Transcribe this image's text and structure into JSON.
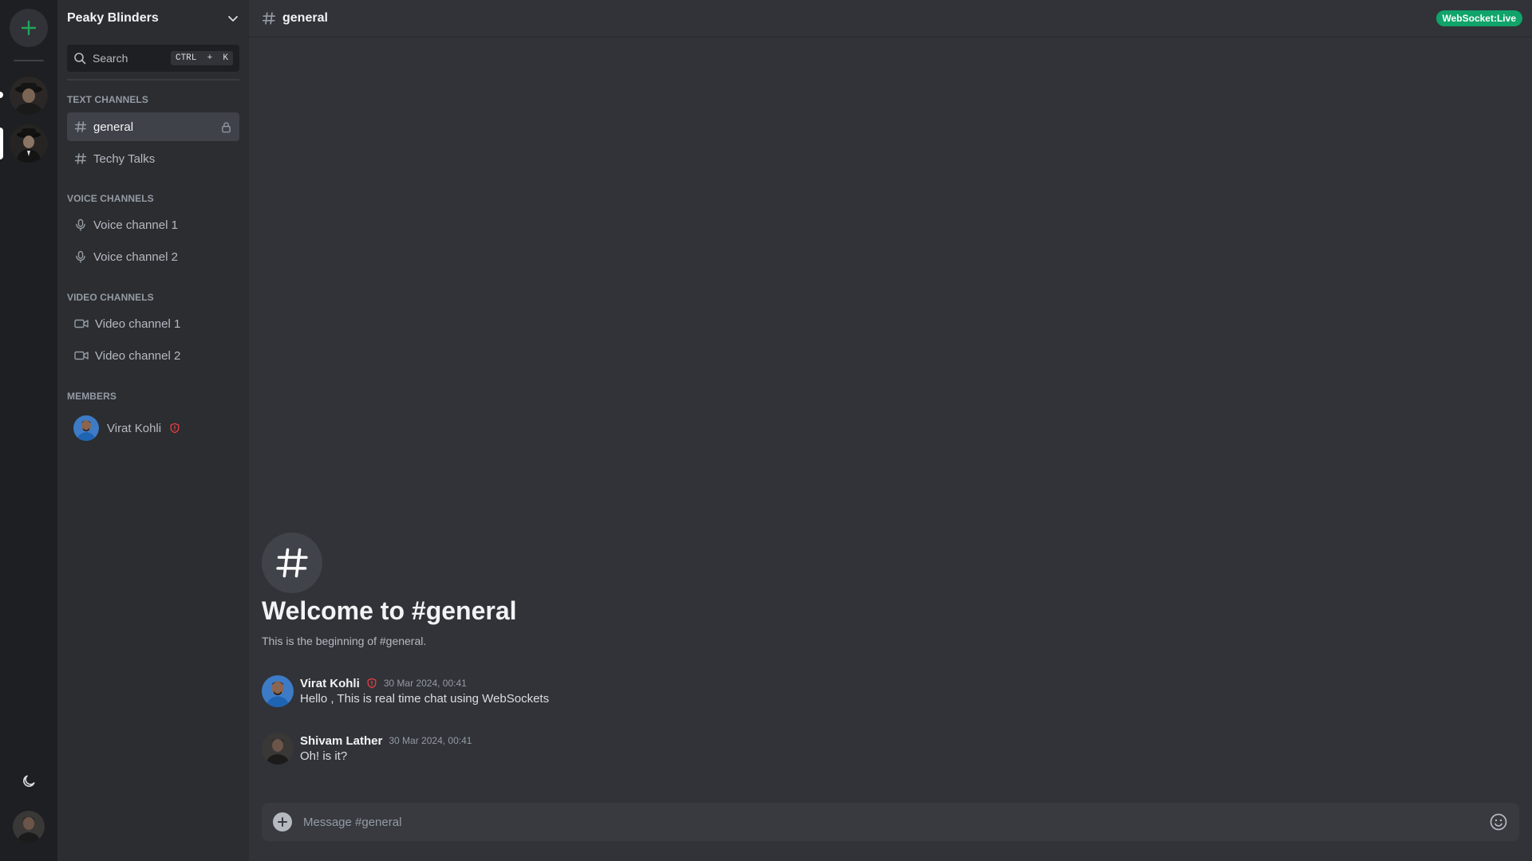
{
  "server": {
    "name": "Peaky Blinders"
  },
  "search": {
    "label": "Search",
    "shortcut_ctrl": "CTRL",
    "shortcut_plus": "+",
    "shortcut_key": "K"
  },
  "sections": {
    "text": "TEXT CHANNELS",
    "voice": "VOICE CHANNELS",
    "video": "VIDEO CHANNELS",
    "members": "MEMBERS"
  },
  "text_channels": [
    {
      "name": "general",
      "active": true,
      "locked": true
    },
    {
      "name": "Techy Talks",
      "active": false,
      "locked": false
    }
  ],
  "voice_channels": [
    {
      "name": "Voice channel 1"
    },
    {
      "name": "Voice channel 2"
    }
  ],
  "video_channels": [
    {
      "name": "Video channel 1"
    },
    {
      "name": "Video channel 2"
    }
  ],
  "members": [
    {
      "name": "Virat Kohli",
      "role_icon": "shield-alert-icon"
    }
  ],
  "header": {
    "channel": "general",
    "status_badge": "WebSocket:Live"
  },
  "welcome": {
    "title": "Welcome to #general",
    "subtitle": "This is the beginning of #general."
  },
  "messages": [
    {
      "author": "Virat Kohli",
      "timestamp": "30 Mar 2024, 00:41",
      "text": "Hello , This is real time chat using WebSockets",
      "role_icon": "shield-alert-icon"
    },
    {
      "author": "Shivam Lather",
      "timestamp": "30 Mar 2024, 00:41",
      "text": "Oh! is it?"
    }
  ],
  "composer": {
    "placeholder": "Message #general"
  },
  "colors": {
    "accent": "#10a46a",
    "add_server": "#23a55a",
    "admin_shield": "#f23f43",
    "bg_main": "#313338",
    "bg_sidebar": "#2b2d31",
    "bg_rail": "#1e1f22"
  }
}
